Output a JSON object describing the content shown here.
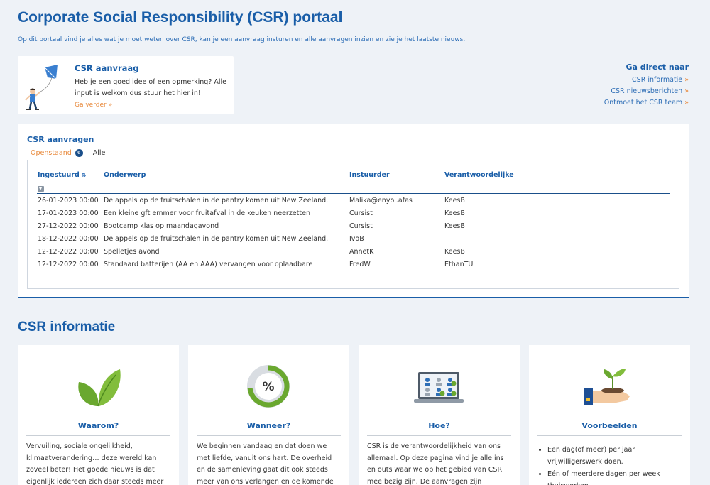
{
  "header": {
    "title": "Corporate Social Responsibility (CSR) portaal",
    "intro": "Op dit portaal vind je alles wat je moet weten over CSR, kan je een aanvraag insturen en alle aanvragen inzien en zie je het laatste nieuws."
  },
  "request_card": {
    "title": "CSR aanvraag",
    "text": "Heb je een goed idee of een opmerking? Alle input is welkom dus stuur het hier in!",
    "link": "Ga verder »"
  },
  "quick_links": {
    "title": "Ga direct naar",
    "items": [
      {
        "label": "CSR informatie",
        "arrow": "»"
      },
      {
        "label": "CSR nieuwsberichten",
        "arrow": "»"
      },
      {
        "label": "Ontmoet het CSR team",
        "arrow": "»"
      }
    ]
  },
  "requests": {
    "title": "CSR aanvragen",
    "tabs": {
      "open_label": "Openstaand",
      "open_count": "6",
      "all_label": "Alle"
    },
    "columns": [
      "Ingestuurd",
      "Onderwerp",
      "Instuurder",
      "Verantwoordelijke"
    ],
    "sort_glyph": "⇅",
    "rows": [
      {
        "date": "26-01-2023 00:00",
        "subject": "De appels op de fruitschalen in de pantry komen uit New Zeeland.",
        "sender": "Malika@enyoi.afas",
        "owner": "KeesB"
      },
      {
        "date": "17-01-2023 00:00",
        "subject": "Een kleine gft emmer voor fruitafval in de keuken neerzetten",
        "sender": "Cursist",
        "owner": "KeesB"
      },
      {
        "date": "27-12-2022 00:00",
        "subject": "Bootcamp klas op maandagavond",
        "sender": "Cursist",
        "owner": "KeesB"
      },
      {
        "date": "18-12-2022 00:00",
        "subject": "De appels op de fruitschalen in de pantry komen uit New Zeeland.",
        "sender": "IvoB",
        "owner": ""
      },
      {
        "date": "12-12-2022 00:00",
        "subject": "Spelletjes avond",
        "sender": "AnnetK",
        "owner": "KeesB"
      },
      {
        "date": "12-12-2022 00:00",
        "subject": "Standaard batterijen (AA en AAA) vervangen voor oplaadbare",
        "sender": "FredW",
        "owner": "EthanTU"
      }
    ]
  },
  "info": {
    "title": "CSR informatie",
    "cards": [
      {
        "title": "Waarom?",
        "text": "Vervuiling, sociale ongelijkheid, klimaatverandering… deze wereld kan zoveel beter! Het goede nieuws is dat eigenlijk iedereen zich daar steeds meer bewust van"
      },
      {
        "title": "Wanneer?",
        "text": "We beginnen vandaag en dat doen we met liefde, vanuit ons hart. De overheid en de samenleving gaat dit ook steeds meer van ons verlangen en de komende jaren ook"
      },
      {
        "title": "Hoe?",
        "text": "CSR is de verantwoordelijkheid van ons allemaal. Op deze pagina vind je alle ins en outs waar we op het gebied van CSR mee bezig zijn. De aanvragen zijn openbaar en"
      },
      {
        "title": "Voorbeelden",
        "bullets": [
          "Een dag(of meer) per jaar vrijwilligerswerk doen.",
          "Eén of meerdere dagen per week thuiswerken."
        ]
      }
    ]
  }
}
